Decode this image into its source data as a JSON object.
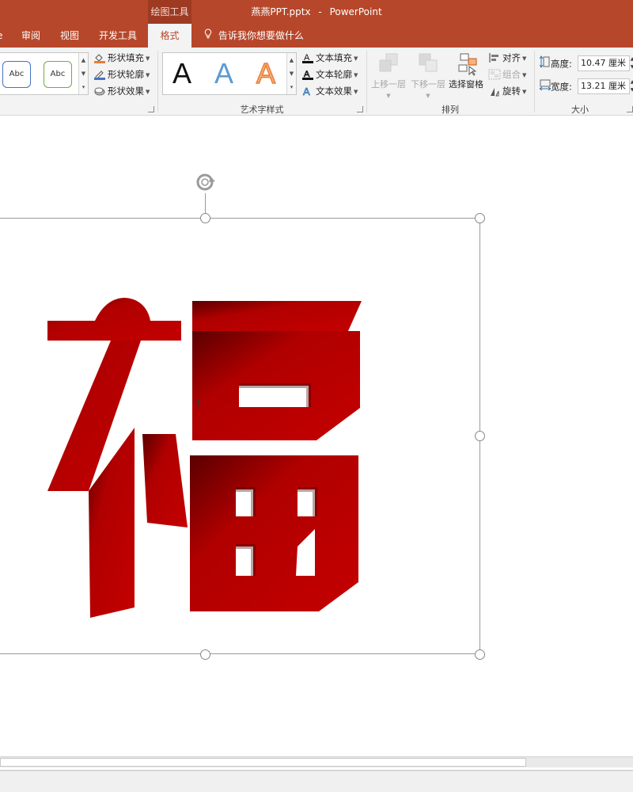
{
  "titlebar": {
    "context_tab": "绘图工具",
    "document_title": "燕燕PPT.pptx",
    "separator": "-",
    "app_name": "PowerPoint"
  },
  "tabs": {
    "partial": "e",
    "review": "审阅",
    "view": "视图",
    "developer": "开发工具",
    "format": "格式",
    "tell_me": "告诉我你想要做什么"
  },
  "shape_styles": {
    "sample_1": "Abc",
    "sample_2": "Abc",
    "fill": "形状填充",
    "outline": "形状轮廓",
    "effects": "形状效果"
  },
  "wordart_styles": {
    "sample_black": "A",
    "sample_blue": "A",
    "sample_orange": "A",
    "text_fill": "文本填充",
    "text_outline": "文本轮廓",
    "text_effects": "文本效果",
    "group_label": "艺术字样式"
  },
  "arrange": {
    "bring_forward": "上移一层",
    "send_backward": "下移一层",
    "selection_pane": "选择窗格",
    "align": "对齐",
    "group": "组合",
    "rotate": "旋转",
    "group_label": "排列"
  },
  "size": {
    "height_label": "高度:",
    "height_value": "10.47 厘米",
    "width_label": "宽度:",
    "width_value": "13.21 厘米",
    "group_label": "大小"
  },
  "slide": {
    "character": "福"
  },
  "colors": {
    "accent": "#b7472a",
    "glyph_red": "#c00000"
  }
}
